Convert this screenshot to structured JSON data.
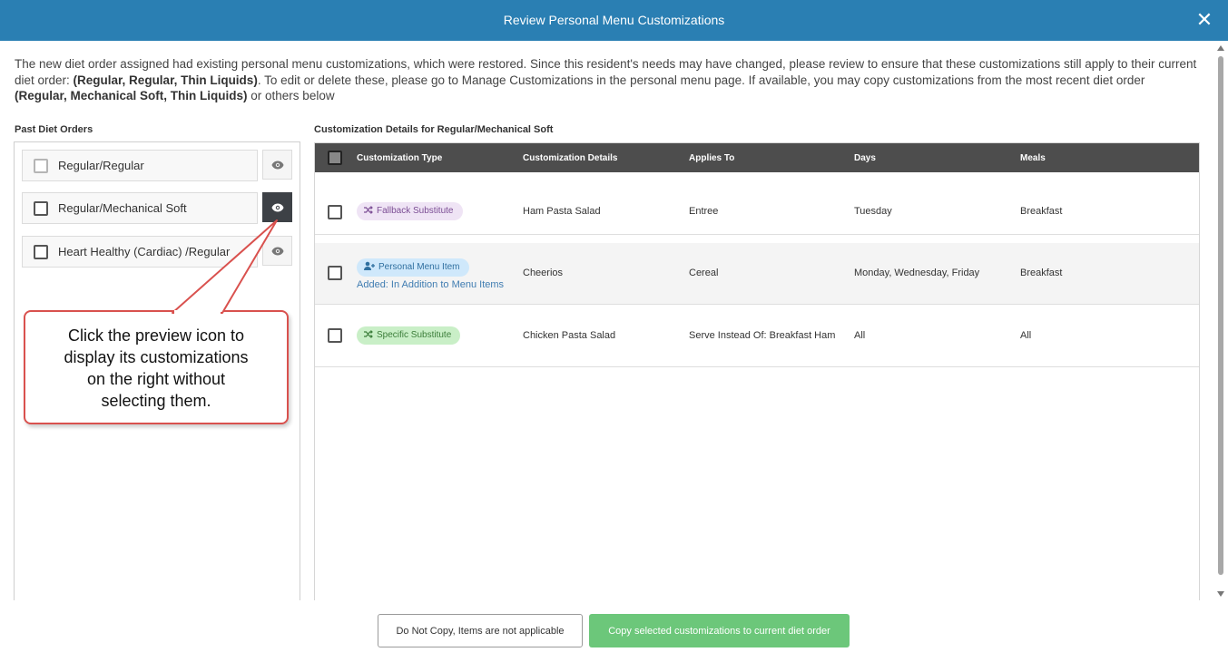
{
  "dialog": {
    "title": "Review Personal Menu Customizations",
    "close_glyph": "✕"
  },
  "intro": {
    "part1": "The new diet order assigned had existing personal menu customizations, which were restored. Since this resident's needs may have changed, please review to ensure that these customizations still apply to their current diet order: ",
    "current_order": "(Regular, Regular, Thin Liquids)",
    "part2": ". To edit or delete these, please go to Manage Customizations in the personal menu page. If available, you may copy customizations from the most recent diet order ",
    "recent_order": "(Regular, Mechanical Soft, Thin Liquids)",
    "part3": " or others below"
  },
  "past_orders": {
    "label": "Past Diet Orders",
    "items": [
      {
        "label": "Regular/Regular",
        "checked": false,
        "preview_active": false
      },
      {
        "label": "Regular/Mechanical Soft",
        "checked": false,
        "preview_active": true
      },
      {
        "label": "Heart Healthy (Cardiac) /Regular",
        "checked": false,
        "preview_active": false
      }
    ]
  },
  "callout": {
    "line1": "Click the preview icon to",
    "line2": "display its customizations",
    "line3": "on the right without",
    "line4": "selecting them.",
    "border_color": "#d9514e"
  },
  "details": {
    "label": "Customization Details for Regular/Mechanical Soft",
    "columns": [
      "Customization Type",
      "Customization Details",
      "Applies To",
      "Days",
      "Meals"
    ],
    "rows": [
      {
        "type": "Fallback Substitute",
        "type_icon": "shuffle-icon",
        "note": "",
        "details": "Ham Pasta Salad",
        "applies_to": "Entree",
        "days": "Tuesday",
        "meals": "Breakfast"
      },
      {
        "type": "Personal Menu Item",
        "type_icon": "person-add-icon",
        "note": "Added: In Addition to Menu Items",
        "details": "Cheerios",
        "applies_to": "Cereal",
        "days": "Monday, Wednesday, Friday",
        "meals": "Breakfast"
      },
      {
        "type": "Specific Substitute",
        "type_icon": "shuffle-icon",
        "note": "",
        "details": "Chicken Pasta Salad",
        "applies_to": "Serve Instead Of: Breakfast Ham",
        "days": "All",
        "meals": "All"
      }
    ]
  },
  "footer": {
    "secondary_label": "Do Not Copy, Items are not applicable",
    "primary_label": "Copy selected customizations to current diet order"
  },
  "colors": {
    "header": "#2a7fb3",
    "primary_button": "#6cc77a",
    "table_header": "#4d4d4d"
  }
}
